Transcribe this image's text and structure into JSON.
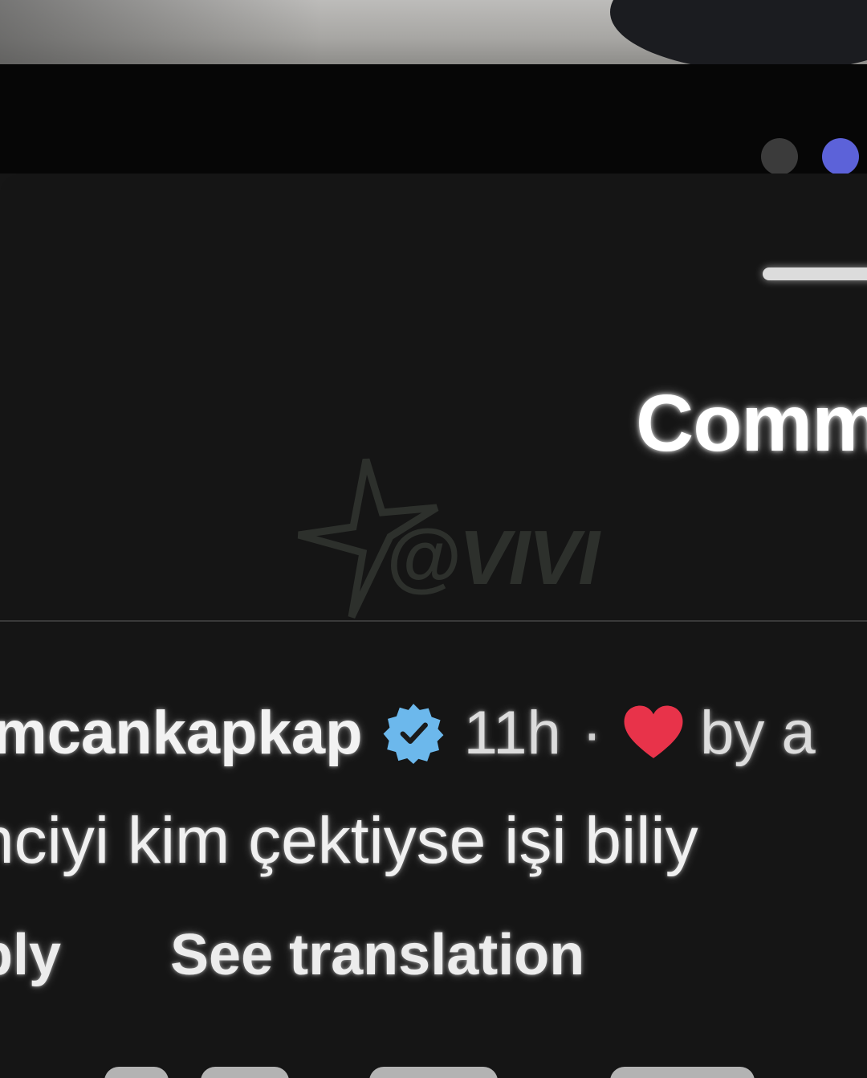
{
  "sheet": {
    "title": "Comm"
  },
  "watermark": {
    "text": "@VIVI"
  },
  "comment": {
    "username": "imcankapkap",
    "verified_icon": "verified-badge-icon",
    "time": "11h",
    "separator": "·",
    "heart_icon": "heart-icon",
    "liked_by": "by a",
    "text": "nciyi kim çektiyse işi biliy",
    "reply_label": "ply",
    "see_translation_label": "See translation"
  },
  "colors": {
    "background": "#151515",
    "verified_blue": "#6cb8ec",
    "heart_red": "#e8334a",
    "carousel_active": "#5c62d9",
    "carousel_inactive": "#3b3b3b"
  }
}
